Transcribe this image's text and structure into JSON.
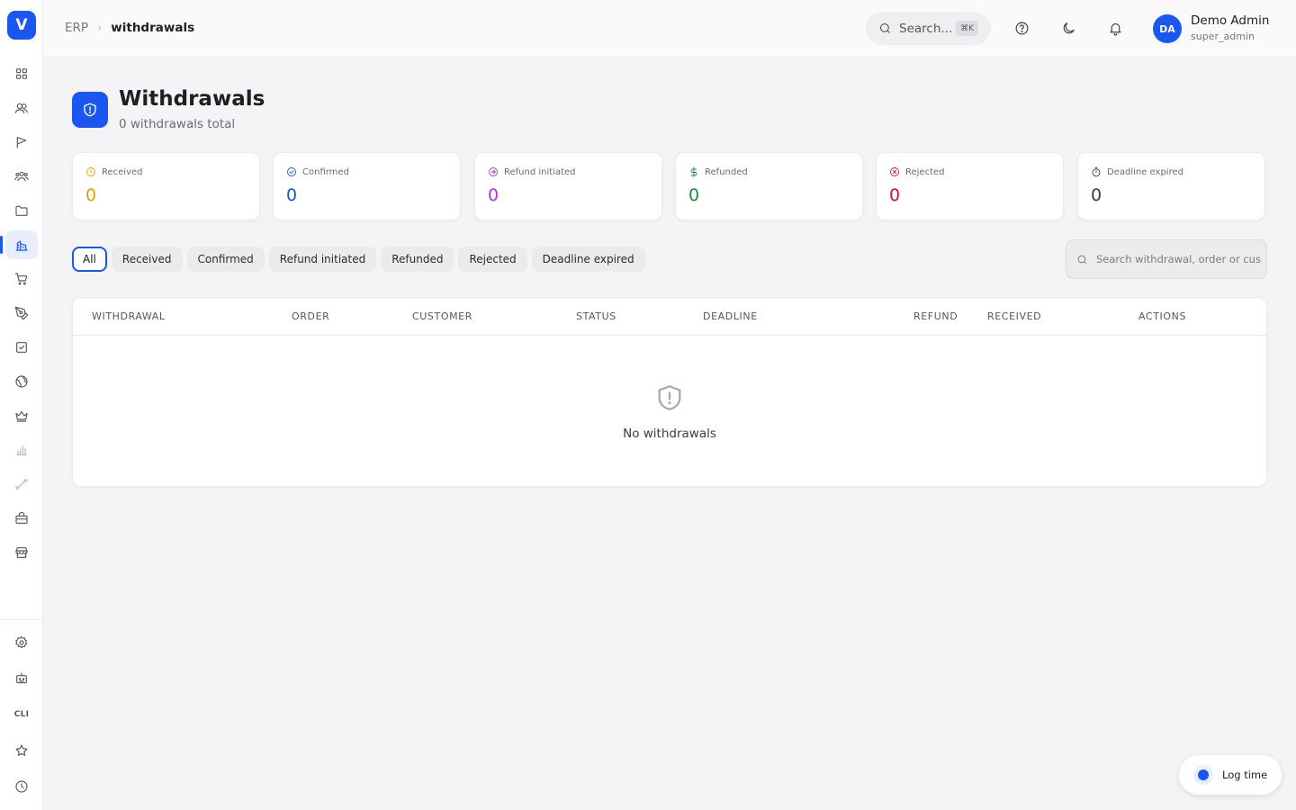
{
  "app": {
    "logo_letter": "V"
  },
  "breadcrumb": {
    "root": "ERP",
    "separator": "›",
    "current": "withdrawals"
  },
  "topbar": {
    "search_placeholder": "Search...",
    "search_shortcut": "⌘K",
    "user": {
      "initials": "DA",
      "name": "Demo Admin",
      "role": "super_admin"
    }
  },
  "page": {
    "title": "Withdrawals",
    "subtitle": "0 withdrawals total"
  },
  "stats": [
    {
      "label": "Received",
      "value": "0",
      "color": "#d4a70a",
      "icon": "clock-icon"
    },
    {
      "label": "Confirmed",
      "value": "0",
      "color": "#1e54c9",
      "icon": "check-circle-icon"
    },
    {
      "label": "Refund initiated",
      "value": "0",
      "color": "#a83ad0",
      "icon": "arrow-circle-icon"
    },
    {
      "label": "Refunded",
      "value": "0",
      "color": "#1f8a3b",
      "icon": "dollar-icon"
    },
    {
      "label": "Rejected",
      "value": "0",
      "color": "#d0142c",
      "icon": "x-circle-icon"
    },
    {
      "label": "Deadline expired",
      "value": "0",
      "color": "#3a3b40",
      "icon": "timer-icon"
    }
  ],
  "filters": {
    "chips": [
      "All",
      "Received",
      "Confirmed",
      "Refund initiated",
      "Refunded",
      "Rejected",
      "Deadline expired"
    ],
    "active": "All",
    "search_placeholder": "Search withdrawal, order or cus"
  },
  "table": {
    "columns": [
      "WITHDRAWAL",
      "ORDER",
      "CUSTOMER",
      "STATUS",
      "DEADLINE",
      "REFUND",
      "RECEIVED",
      "ACTIONS"
    ],
    "empty_text": "No withdrawals"
  },
  "sidebar": {
    "items": [
      "dashboard-icon",
      "contacts-icon",
      "campaigns-icon",
      "team-icon",
      "files-icon",
      "erp-icon",
      "cart-icon",
      "design-icon",
      "tasks-icon",
      "globe-icon",
      "crown-icon",
      "analytics-icon",
      "routes-icon",
      "shop-icon",
      "store-icon"
    ],
    "bottom": {
      "cli_label": "CLI"
    }
  },
  "log_time": {
    "label": "Log time"
  },
  "colors": {
    "accent": "#1a56f0"
  }
}
